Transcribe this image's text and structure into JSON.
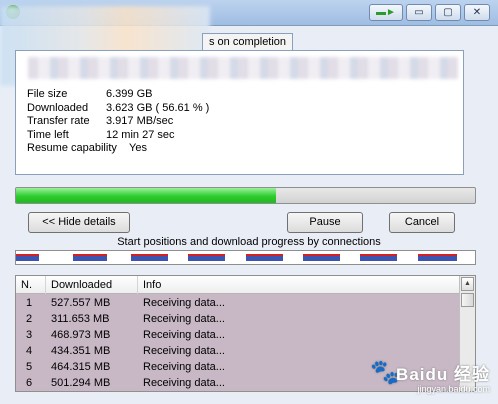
{
  "tab": {
    "label": "s on completion"
  },
  "info": [
    {
      "key": "File size",
      "value": "6.399  GB"
    },
    {
      "key": "Downloaded",
      "value": "3.623  GB  ( 56.61 % )"
    },
    {
      "key": "Transfer rate",
      "value": "3.917  MB/sec"
    },
    {
      "key": "Time left",
      "value": "12 min 27 sec"
    },
    {
      "key": "Resume capability",
      "value": "Yes"
    }
  ],
  "progress": {
    "percent": 56.61,
    "color": "#2ecc2e"
  },
  "buttons": {
    "hide_details": "<< Hide details",
    "pause": "Pause",
    "cancel": "Cancel"
  },
  "connections": {
    "caption": "Start positions and download progress by connections",
    "segments": [
      {
        "start": 0.0,
        "end": 0.05
      },
      {
        "start": 0.125,
        "end": 0.2
      },
      {
        "start": 0.25,
        "end": 0.33
      },
      {
        "start": 0.375,
        "end": 0.455
      },
      {
        "start": 0.5,
        "end": 0.58
      },
      {
        "start": 0.625,
        "end": 0.705
      },
      {
        "start": 0.75,
        "end": 0.83
      },
      {
        "start": 0.875,
        "end": 0.96
      }
    ]
  },
  "table": {
    "headers": [
      "N.",
      "Downloaded",
      "Info"
    ],
    "rows": [
      {
        "n": "1",
        "downloaded": "527.557  MB",
        "info": "Receiving data..."
      },
      {
        "n": "2",
        "downloaded": "311.653  MB",
        "info": "Receiving data..."
      },
      {
        "n": "3",
        "downloaded": "468.973  MB",
        "info": "Receiving data..."
      },
      {
        "n": "4",
        "downloaded": "434.351  MB",
        "info": "Receiving data..."
      },
      {
        "n": "5",
        "downloaded": "464.315  MB",
        "info": "Receiving data..."
      },
      {
        "n": "6",
        "downloaded": "501.294  MB",
        "info": "Receiving data..."
      }
    ]
  },
  "watermark": {
    "brand": "Baidu 经验",
    "url": "jingyan.baidu.com"
  }
}
